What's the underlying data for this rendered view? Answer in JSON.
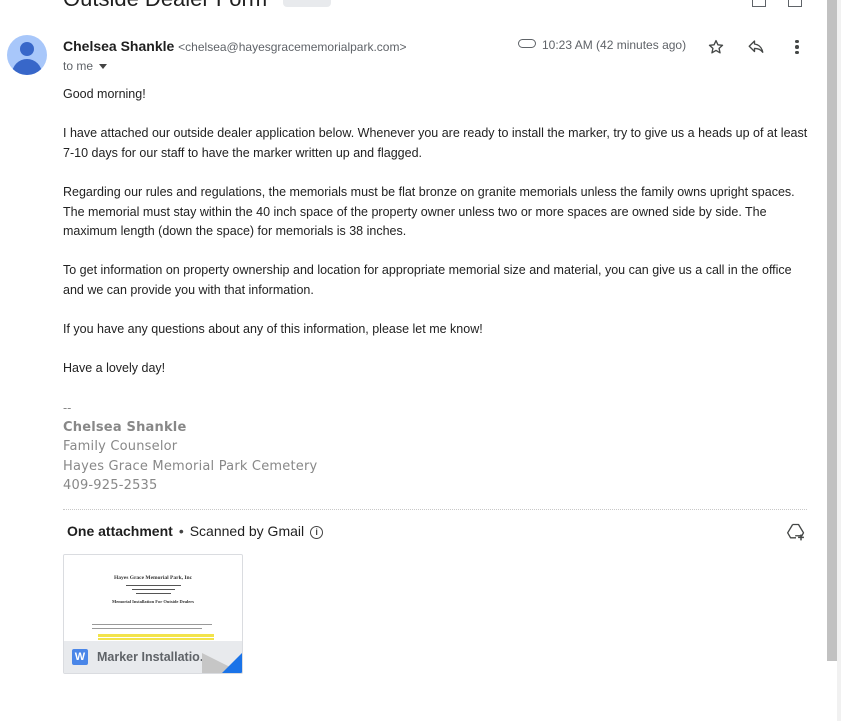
{
  "email": {
    "subject": "Outside Dealer Form",
    "sender": {
      "name": "Chelsea Shankle",
      "email": "<chelsea@hayesgracememorialpark.com>"
    },
    "recipient_label": "to me",
    "timestamp": "10:23 AM (42 minutes ago)",
    "body": [
      "Good morning!",
      "I have attached our outside dealer application below. Whenever you are ready to install the marker, try to give us a heads up of at least 7-10 days for our staff to have the marker written up and flagged.",
      "Regarding our rules and regulations, the memorials must be flat bronze on granite memorials unless the family owns upright spaces. The memorial must stay within the 40 inch space of the property owner unless two or more spaces are owned side by side. The maximum length (down the space) for memorials is 38 inches.",
      "To get information on property ownership and location for appropriate memorial size and material, you can give us a call in the office and we can provide you with that information.",
      "If you have any questions about any of this information, please let me know!",
      "Have a lovely day!"
    ],
    "signature": {
      "separator": "--",
      "name": "Chelsea Shankle",
      "title": "Family Counselor",
      "organization": "Hayes Grace Memorial Park Cemetery",
      "phone": "409-925-2535"
    }
  },
  "attachments": {
    "header": "One attachment",
    "dot": "•",
    "scanned": "Scanned by Gmail",
    "items": [
      {
        "name": "Marker Installatio...",
        "file_type_letter": "W",
        "preview_title": "Hayes Grace Memorial Park, Inc",
        "preview_heading": "Memorial Installation For Outside Dealers"
      }
    ]
  },
  "icons": {
    "attachment": "paperclip-icon",
    "star": "star-icon",
    "reply": "reply-icon",
    "more": "more-vert-icon",
    "info": "info-icon",
    "drive": "add-to-drive-icon"
  },
  "colors": {
    "avatar_bg": "#a8c7fa",
    "avatar_fg": "#3867c9",
    "word_blue": "#4a86e8",
    "corner_blue": "#1a73e8",
    "signature_grey": "#888888"
  }
}
